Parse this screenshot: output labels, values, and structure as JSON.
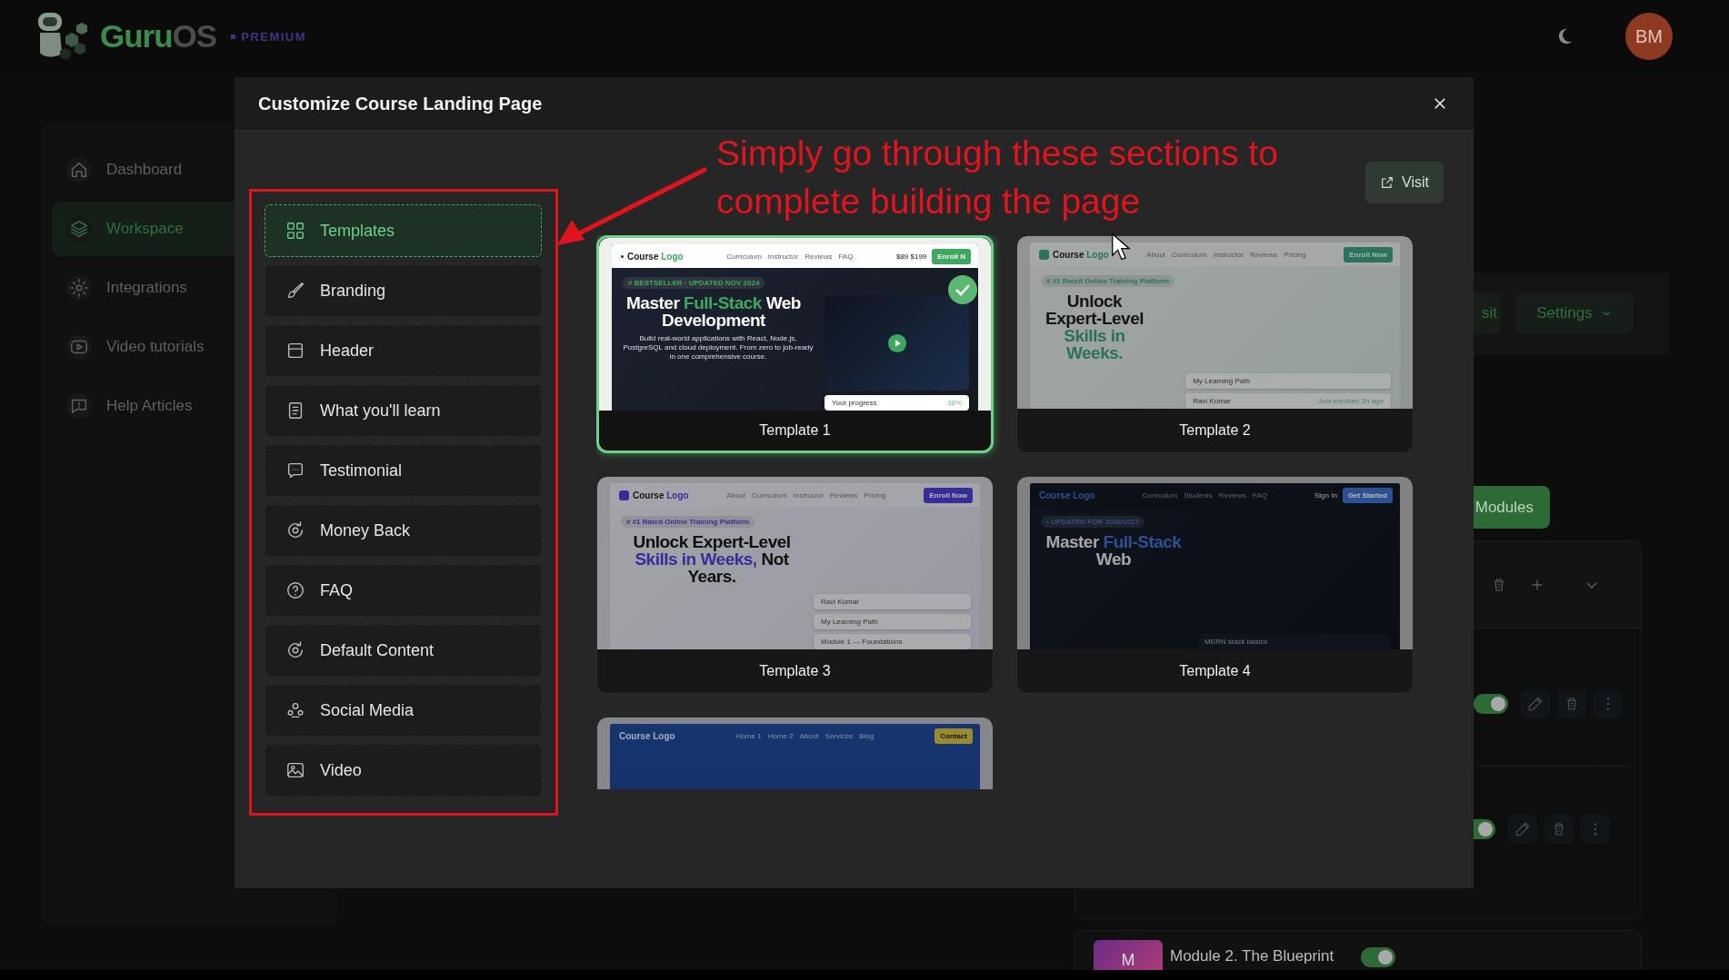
{
  "brand": {
    "name": "Guru",
    "name_suffix": "OS",
    "tier": "PREMIUM"
  },
  "user": {
    "initials": "BM"
  },
  "sidebar": {
    "items": [
      {
        "label": "Dashboard",
        "selected": false
      },
      {
        "label": "Workspace",
        "selected": true
      },
      {
        "label": "Integrations",
        "selected": false
      },
      {
        "label": "Video tutorials",
        "selected": false
      },
      {
        "label": "Help Articles",
        "selected": false
      }
    ]
  },
  "page_behind": {
    "visit_button": "sit",
    "settings_button": "Settings",
    "modules_button": "Modules",
    "lessons": [
      {
        "on": true
      },
      {
        "on": true
      }
    ],
    "next_module": {
      "thumb": "M",
      "title": "Module 2. The Blueprint",
      "on": true
    }
  },
  "modal": {
    "title": "Customize Course Landing Page",
    "visit_button": "Visit",
    "sections": [
      {
        "label": "Templates",
        "selected": true
      },
      {
        "label": "Branding",
        "selected": false
      },
      {
        "label": "Header",
        "selected": false
      },
      {
        "label": "What you'll learn",
        "selected": false
      },
      {
        "label": "Testimonial",
        "selected": false
      },
      {
        "label": "Money Back",
        "selected": false
      },
      {
        "label": "FAQ",
        "selected": false
      },
      {
        "label": "Default Content",
        "selected": false
      },
      {
        "label": "Social Media",
        "selected": false
      },
      {
        "label": "Video",
        "selected": false
      }
    ],
    "templates": [
      {
        "name": "Template 1",
        "selected": true,
        "preview": {
          "kind": "dark-green",
          "logo": [
            {
              "text": "Course ",
              "accent": false
            },
            {
              "text": "Logo",
              "accent": true
            }
          ],
          "nav": [
            "Curriculum",
            "Instructor",
            "Reviews",
            "FAQ"
          ],
          "actions": [
            {
              "text": "$89 $199",
              "kind": "link"
            },
            {
              "text": "Enroll N",
              "kind": "button"
            }
          ],
          "badge": "# BESTSELLER · UPDATED NOV 2024",
          "headline": [
            {
              "text": "Master ",
              "accent": false
            },
            {
              "text": "Full-Stack",
              "accent": true
            },
            {
              "text": " Web Development",
              "accent": false
            }
          ],
          "description": "Build real-world applications with React, Node.js, PostgreSQL and cloud deployment. From zero to job-ready in one comprehensive course.",
          "video": true,
          "widgets": [
            {
              "label": "Your progress",
              "value": "38%"
            }
          ]
        }
      },
      {
        "name": "Template 2",
        "selected": false,
        "preview": {
          "kind": "light-teal",
          "logo": [
            {
              "text": "Course ",
              "accent": false
            },
            {
              "text": "Logo",
              "accent": true
            }
          ],
          "nav": [
            "About",
            "Curriculum",
            "Instructor",
            "Reviews",
            "Pricing"
          ],
          "actions": [
            {
              "text": "Enroll Now",
              "kind": "button"
            }
          ],
          "badge": "# #1 Rated Online Training Platform",
          "headline": [
            {
              "text": "Unlock Expert-Level ",
              "accent": false
            },
            {
              "text": "Skills in Weeks.",
              "accent": true
            }
          ],
          "widgets": [
            {
              "label": "My Learning Path"
            },
            {
              "label": "Ravi Kumar",
              "value": "Just enrolled 2h ago"
            }
          ]
        }
      },
      {
        "name": "Template 3",
        "selected": false,
        "preview": {
          "kind": "light-purple",
          "logo": [
            {
              "text": "Course ",
              "accent": false
            },
            {
              "text": "Logo",
              "accent": true
            }
          ],
          "nav": [
            "About",
            "Curriculum",
            "Instructor",
            "Reviews",
            "Pricing"
          ],
          "actions": [
            {
              "text": "Enroll Now",
              "kind": "button"
            }
          ],
          "badge": "# #1 Rated Online Training Platform",
          "headline": [
            {
              "text": "Unlock Expert-Level ",
              "accent": false
            },
            {
              "text": "Skills in Weeks,",
              "accent": true
            },
            {
              "text": " Not Years.",
              "accent": false
            }
          ],
          "widgets": [
            {
              "label": "Ravi Kumar"
            },
            {
              "label": "My Learning Path"
            },
            {
              "label": "Module 1 — Foundations"
            }
          ]
        }
      },
      {
        "name": "Template 4",
        "selected": false,
        "preview": {
          "kind": "dark-blue",
          "logo": [
            {
              "text": "Course Logo",
              "accent": true
            }
          ],
          "nav": [
            "Curriculum",
            "Students",
            "Reviews",
            "FAQ"
          ],
          "actions": [
            {
              "text": "Sign In",
              "kind": "link"
            },
            {
              "text": "Get Started",
              "kind": "button"
            }
          ],
          "badge": "• UPDATED FOR 2026/2027",
          "headline": [
            {
              "text": "Master ",
              "accent": false
            },
            {
              "text": "Full-Stack",
              "accent": true
            },
            {
              "text": " Web",
              "accent": false
            }
          ],
          "widgets": [
            {
              "label": "MERN stack basics"
            }
          ]
        }
      },
      {
        "selected": false,
        "preview": {
          "kind": "royal-blue",
          "logo": [
            {
              "text": "Course Logo",
              "accent": false
            }
          ],
          "nav": [
            "Home 1",
            "Home 2",
            "About",
            "Services",
            "Blog"
          ],
          "actions": [
            {
              "text": "Contact",
              "kind": "button"
            }
          ]
        }
      }
    ]
  },
  "annotation": {
    "lines": [
      "Simply go through these sections to",
      "complete building the page"
    ]
  }
}
